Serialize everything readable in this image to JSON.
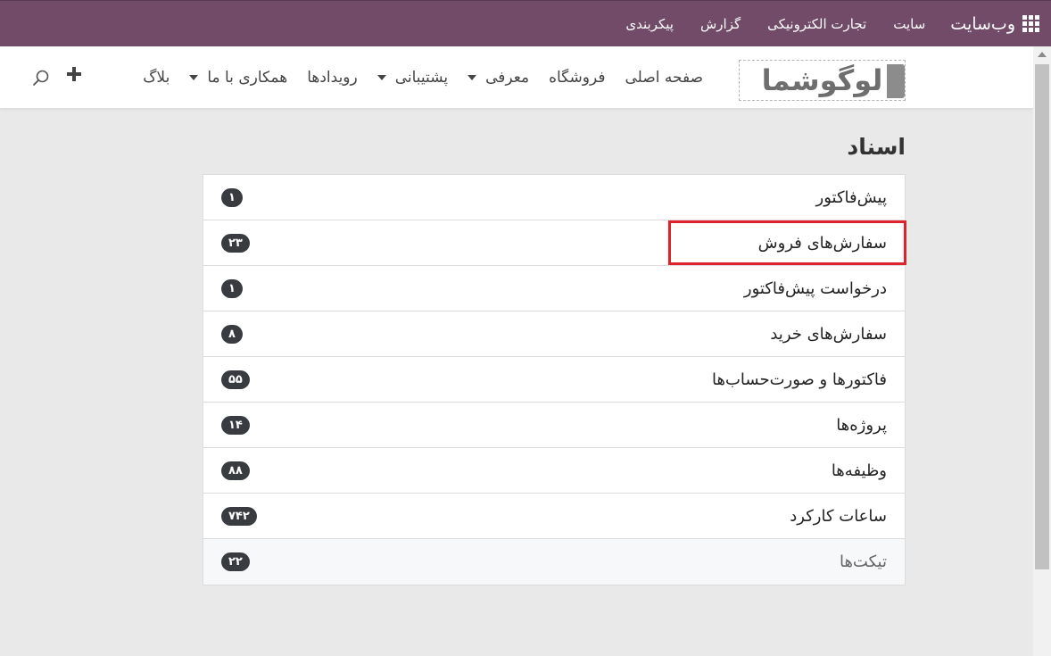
{
  "topbar": {
    "brand": "وب‌سایت",
    "menu": [
      "سایت",
      "تجارت الکترونیکی",
      "گزارش",
      "پیکربندی"
    ],
    "accent_color": "#714b67"
  },
  "header": {
    "logo_text": "لوگوشما",
    "nav": [
      {
        "label": "صفحه اصلی",
        "dropdown": false
      },
      {
        "label": "فروشگاه",
        "dropdown": false
      },
      {
        "label": "معرفی",
        "dropdown": true
      },
      {
        "label": "پشتیبانی",
        "dropdown": true
      },
      {
        "label": "رویدادها",
        "dropdown": false
      },
      {
        "label": "همکاری با ما",
        "dropdown": true
      },
      {
        "label": "بلاگ",
        "dropdown": false
      }
    ],
    "icons": [
      "plus-icon",
      "search-icon"
    ]
  },
  "main": {
    "title": "اسناد",
    "documents": [
      {
        "label": "پیش‌فاکتور",
        "count": "۱"
      },
      {
        "label": "سفارش‌های فروش",
        "count": "۲۳"
      },
      {
        "label": "درخواست پیش‌فاکتور",
        "count": "۱"
      },
      {
        "label": "سفارش‌های خرید",
        "count": "۸"
      },
      {
        "label": "فاکتورها و صورت‌حساب‌ها",
        "count": "۵۵"
      },
      {
        "label": "پروژه‌ها",
        "count": "۱۴"
      },
      {
        "label": "وظیفه‌ها",
        "count": "۸۸"
      },
      {
        "label": "ساعات کارکرد",
        "count": "۷۴۲"
      },
      {
        "label": "تیکت‌ها",
        "count": "۲۲"
      }
    ],
    "highlight_color": "#e0222d"
  }
}
